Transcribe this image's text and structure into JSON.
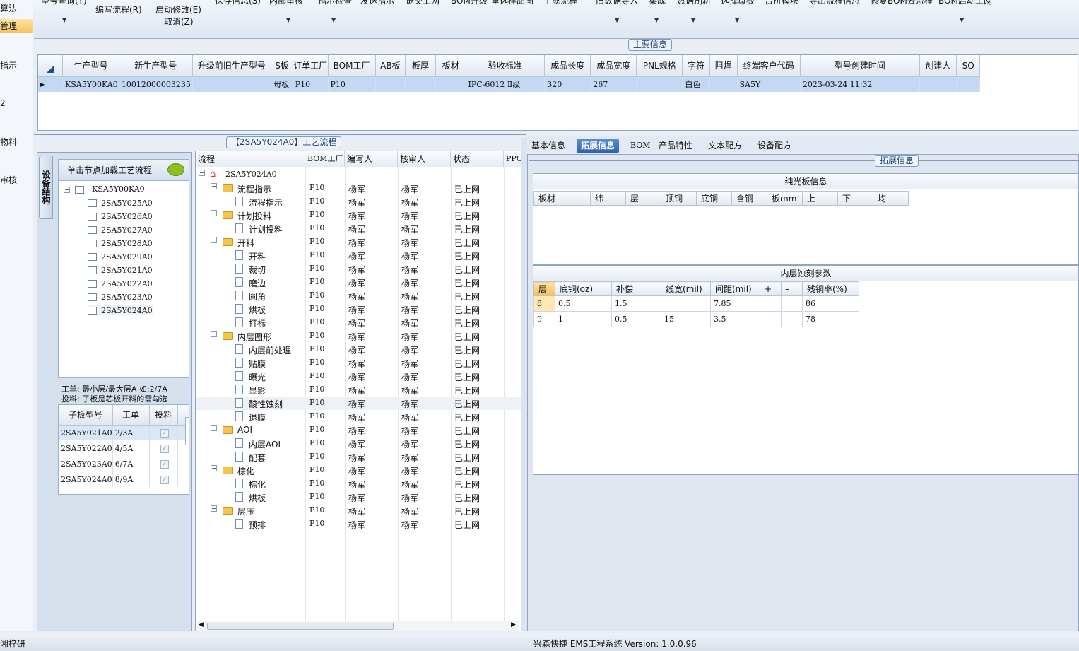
{
  "leftnav": {
    "items": [
      "算法",
      "管理",
      "指示",
      "2",
      "物料",
      "审核"
    ]
  },
  "toolbar": {
    "items": [
      "型号查询(Y)",
      "编写流程(R)",
      "启动修改(E)",
      "取消(Z)",
      "保存信息(S)",
      "内部审核",
      "指示检查",
      "发送指示",
      "提交上网",
      "BOM升级",
      "重选样品图",
      "生成流程",
      "旧数据导入",
      "集成",
      "数据刷新",
      "选择母板",
      "合拼模块",
      "导出流程信息",
      "修复BOM云流程",
      "BOM启动工网"
    ]
  },
  "main_info": {
    "title": "主要信息",
    "columns": [
      "生产型号",
      "新生产型号",
      "升级前旧生产型号",
      "S板",
      "订单工厂",
      "BOM工厂",
      "AB板",
      "板厚",
      "板材",
      "验收标准",
      "成品长度",
      "成品宽度",
      "PNL规格",
      "字符",
      "阻焊",
      "终端客户代码",
      "型号创建时间",
      "创建人",
      "SO"
    ],
    "row": [
      "KSA5Y00KA0",
      "10012000003235",
      "",
      "母板",
      "P10",
      "P10",
      "",
      "",
      "",
      "IPC-6012 Ⅱ级",
      "320",
      "267",
      "",
      "白色",
      "",
      "SA5Y",
      "2023-03-24 11:32",
      "",
      ""
    ]
  },
  "left_panel": {
    "vertical_tab": "设备结构",
    "load_button": "单击节点加载工艺流程",
    "tree_root": "KSA5Y00KA0",
    "tree_children": [
      "2SA5Y025A0",
      "2SA5Y026A0",
      "2SA5Y027A0",
      "2SA5Y028A0",
      "2SA5Y029A0",
      "2SA5Y021A0",
      "2SA5Y022A0",
      "2SA5Y023A0",
      "2SA5Y024A0"
    ],
    "hint1": "工单: 最小层/最大层A 如:2/7A",
    "hint2": "投料: 子板是芯板开料的需勾选",
    "sub_columns": [
      "子板型号",
      "工单",
      "投料"
    ],
    "sub_rows": [
      [
        "2SA5Y021A0",
        "2/3A"
      ],
      [
        "2SA5Y022A0",
        "4/5A"
      ],
      [
        "2SA5Y023A0",
        "6/7A"
      ],
      [
        "2SA5Y024A0",
        "8/9A"
      ]
    ]
  },
  "process_panel": {
    "title": "【2SA5Y024A0】工艺流程",
    "columns": [
      "流程",
      "BOM工厂",
      "编写人",
      "核审人",
      "状态",
      "PPC"
    ],
    "root": "2SA5Y024A0",
    "rows": [
      {
        "level": 1,
        "type": "folder",
        "name": "流程指示"
      },
      {
        "level": 2,
        "type": "doc",
        "name": "流程指示"
      },
      {
        "level": 1,
        "type": "folder",
        "name": "计划投料"
      },
      {
        "level": 2,
        "type": "doc",
        "name": "计划投料"
      },
      {
        "level": 1,
        "type": "folder",
        "name": "开料"
      },
      {
        "level": 2,
        "type": "doc",
        "name": "开料"
      },
      {
        "level": 2,
        "type": "doc",
        "name": "裁切"
      },
      {
        "level": 2,
        "type": "doc",
        "name": "磨边"
      },
      {
        "level": 2,
        "type": "doc",
        "name": "圆角"
      },
      {
        "level": 2,
        "type": "doc",
        "name": "烘板"
      },
      {
        "level": 2,
        "type": "doc",
        "name": "打标"
      },
      {
        "level": 1,
        "type": "folder",
        "name": "内层图形"
      },
      {
        "level": 2,
        "type": "doc",
        "name": "内层前处理"
      },
      {
        "level": 2,
        "type": "doc",
        "name": "贴膜"
      },
      {
        "level": 2,
        "type": "doc",
        "name": "曝光"
      },
      {
        "level": 2,
        "type": "doc",
        "name": "显影"
      },
      {
        "level": 2,
        "type": "doc",
        "name": "酸性蚀刻"
      },
      {
        "level": 2,
        "type": "doc",
        "name": "退膜"
      },
      {
        "level": 1,
        "type": "folder",
        "name": "AOI"
      },
      {
        "level": 2,
        "type": "doc",
        "name": "内层AOI"
      },
      {
        "level": 2,
        "type": "doc",
        "name": "配套"
      },
      {
        "level": 1,
        "type": "folder",
        "name": "棕化"
      },
      {
        "level": 2,
        "type": "doc",
        "name": "棕化"
      },
      {
        "level": 2,
        "type": "doc",
        "name": "烘板"
      },
      {
        "level": 1,
        "type": "folder",
        "name": "层压"
      },
      {
        "level": 2,
        "type": "doc",
        "name": "预排"
      }
    ],
    "bom": "P10",
    "writer": "杨军",
    "reviewer": "杨军",
    "status": "已上网"
  },
  "right_panel": {
    "tabs": [
      "基本信息",
      "拓展信息",
      "BOM",
      "产品特性",
      "文本配方",
      "设备配方"
    ],
    "active_tab": "拓展信息",
    "section_title": "拓展信息",
    "box1_title": "纯光板信息",
    "box1_columns": [
      "板材",
      "纬",
      "层",
      "顶铜",
      "底铜",
      "含铜",
      "板mm",
      "上",
      "下",
      "均"
    ],
    "box2_title": "内层蚀刻参数",
    "box2_columns": [
      "层",
      "底铜(oz)",
      "补偿",
      "线宽(mil)",
      "间距(mil)",
      "+",
      "-",
      "残铜率(%)"
    ],
    "box2_rows": [
      [
        "8",
        "0.5",
        "1.5",
        "",
        "7.85",
        "",
        "",
        "86"
      ],
      [
        "9",
        "1",
        "0.5",
        "15",
        "3.5",
        "",
        "",
        "78"
      ]
    ]
  },
  "status": {
    "left": "湘梓研",
    "center": "兴森快捷 EMS工程系统 Version: 1.0.0.96"
  }
}
